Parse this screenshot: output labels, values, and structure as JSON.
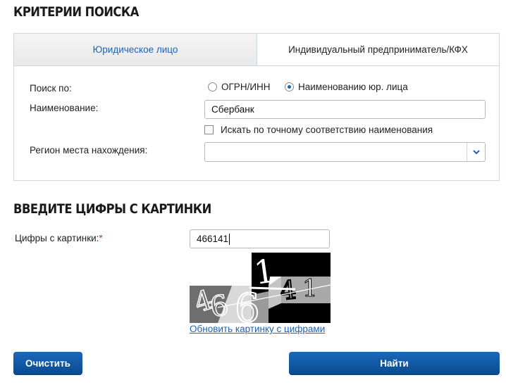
{
  "search_criteria": {
    "title": "КРИТЕРИИ ПОИСКА",
    "tabs": [
      {
        "label": "Юридическое лицо",
        "active": true
      },
      {
        "label": "Индивидуальный предприниматель/КФХ",
        "active": false
      }
    ],
    "search_by": {
      "label": "Поиск по:",
      "options": [
        {
          "label": "ОГРН/ИНН",
          "checked": false
        },
        {
          "label": "Наименованию юр. лица",
          "checked": true
        }
      ]
    },
    "name": {
      "label": "Наименование:",
      "value": "Сбербанк"
    },
    "exact_match": {
      "label": "Искать по точному соответствию наименования",
      "checked": false
    },
    "region": {
      "label": "Регион места нахождения:",
      "value": ""
    }
  },
  "captcha": {
    "title": "ВВЕДИТЕ ЦИФРЫ С КАРТИНКИ",
    "label": "Цифры с картинки:",
    "required_mark": "*",
    "value": "466141",
    "refresh_link": "Обновить картинку с цифрами"
  },
  "buttons": {
    "clear": "Очистить",
    "find": "Найти"
  },
  "colors": {
    "accent": "#1d63b4",
    "button_gradient_top": "#1a68b9",
    "button_gradient_bottom": "#0a4a8f",
    "panel_border": "#c9d7e0",
    "required": "#d9262b"
  },
  "icons": {
    "select_arrow": "chevron-down-icon"
  }
}
